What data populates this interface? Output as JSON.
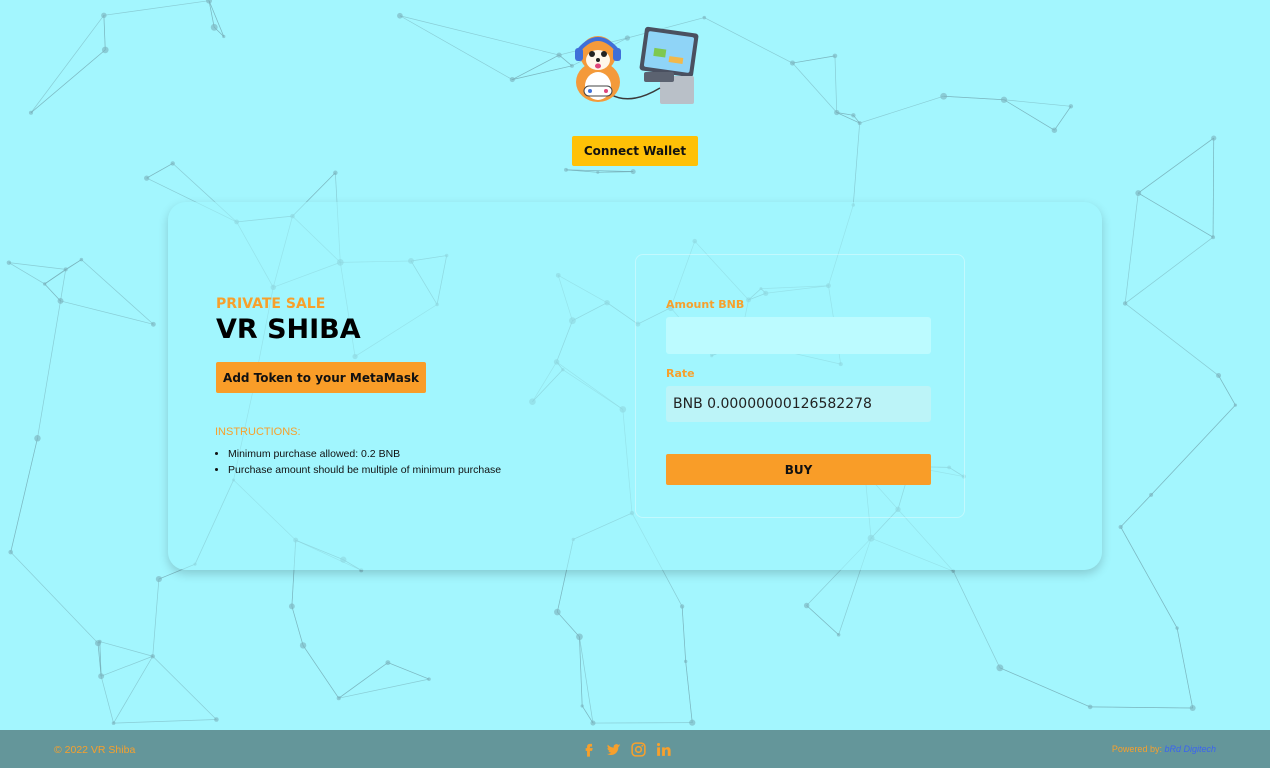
{
  "header": {
    "connect_wallet_label": "Connect Wallet"
  },
  "sale": {
    "label": "PRIVATE SALE",
    "title": "VR SHIBA",
    "add_token_label": "Add Token to your MetaMask",
    "instructions_heading": "INSTRUCTIONS:",
    "instructions": [
      "Minimum purchase allowed: 0.2 BNB",
      "Purchase amount should be multiple of minimum purchase"
    ]
  },
  "form": {
    "amount_label": "Amount BNB",
    "amount_value": "",
    "rate_label": "Rate",
    "rate_value": "BNB 0.00000000126582278",
    "buy_label": "BUY"
  },
  "footer": {
    "copyright": "© 2022 VR Shiba",
    "powered_by_prefix": "Powered by:",
    "powered_by_brand": "bRd Digitech",
    "social_icons": [
      "facebook-icon",
      "twitter-icon",
      "instagram-icon",
      "linkedin-icon"
    ]
  },
  "colors": {
    "background": "#a3f6fe",
    "accent_orange": "#f99d28",
    "connect_yellow": "#ffc107",
    "footer_bg": "#64969a",
    "link_blue": "#3b63f0"
  }
}
